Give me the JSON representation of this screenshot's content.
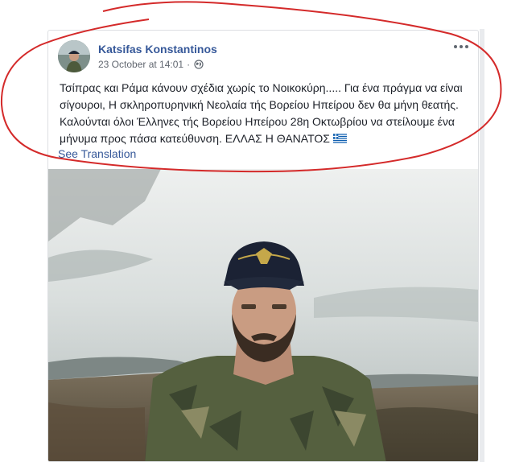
{
  "post": {
    "author": "Katsifas Konstantinos",
    "timestamp": "23 October at 14:01",
    "separator": "·",
    "privacy_icon": "globe-icon",
    "text": "Τσίπρας και Ράμα κάνουν σχέδια χωρίς το Νοικοκύρη..... Για ένα πράγμα να είναι σίγουροι, Η σκληροπυρηνική Νεολαία τής Βορείου Ηπείρου δεν θα μήνη θεατής. Καλούνται όλοι Έλληνες τής Βορείου Ηπείρου 28η Οκτωβρίου να στείλουμε ένα μήνυμα προς πάσα κατεύθυνση. ΕΛΛΑΣ Η ΘΑΝΑΤΟΣ",
    "flag_icon": "greek-flag-icon",
    "see_translation": "See Translation",
    "more_icon": "more-options-icon"
  },
  "colors": {
    "author_link": "#365899",
    "meta_text": "#616770",
    "body_text": "#1d2129",
    "annotation_red": "#d42a2a",
    "flag_blue": "#0d5eaf"
  }
}
